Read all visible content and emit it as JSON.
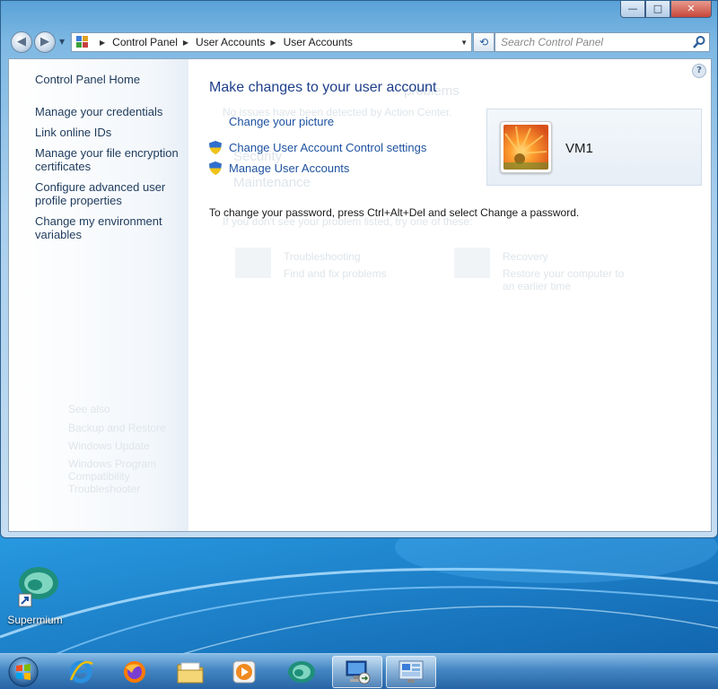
{
  "window": {
    "caption": {
      "minimize": "—",
      "maximize": "□",
      "close": "✕"
    },
    "address": {
      "crumbs": [
        "Control Panel",
        "User Accounts",
        "User Accounts"
      ]
    },
    "search": {
      "placeholder": "Search Control Panel"
    }
  },
  "left_pane": {
    "home": "Control Panel Home",
    "links": [
      "Manage your credentials",
      "Link online IDs",
      "Manage your file encryption certificates",
      "Configure advanced user profile properties",
      "Change my environment variables"
    ]
  },
  "main": {
    "title": "Make changes to your user account",
    "change_picture": "Change your picture",
    "uac_settings": "Change User Account Control settings",
    "manage_accounts": "Manage User Accounts",
    "password_note": "To change your password, press Ctrl+Alt+Del and select Change a password."
  },
  "user": {
    "name": "VM1"
  },
  "ghost_text": {
    "heading": "problems",
    "info": "No issues have been detected by Action Center.",
    "security": "Security",
    "maintenance": "Maintenance",
    "hint": "If you don't see your problem listed, try one of these:",
    "troubleshooting": "Troubleshooting",
    "troubleshooting_desc": "Find and fix problems",
    "recovery": "Recovery",
    "recovery_desc": "Restore your computer to an earlier time",
    "see_also": "See also",
    "backup": "Backup and Restore",
    "windows_update": "Windows Update",
    "compat": "Windows Program Compatibility Troubleshooter"
  },
  "desktop": {
    "icon_label": "Supermium"
  },
  "icons": {
    "back": "back-arrow-icon",
    "forward": "forward-arrow-icon",
    "refresh": "refresh-icon",
    "search": "search-icon",
    "shield": "uac-shield-icon",
    "help": "help-icon"
  },
  "colors": {
    "link": "#1e52a0",
    "title": "#1e3f8a",
    "taskbar": "#2f74b8"
  }
}
